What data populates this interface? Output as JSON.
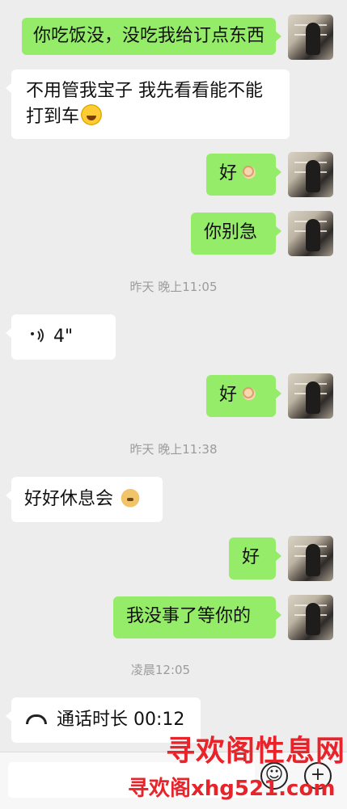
{
  "messages": [
    {
      "side": "right",
      "text": "你吃饭没，没吃我给订点东西"
    },
    {
      "side": "left",
      "line1": "不用管我宝子 我先看看能不能",
      "line2": "打到车",
      "emoji": "laughing-crying-emoji"
    },
    {
      "side": "right",
      "text": "好",
      "emoji": "ok-hand-emoji"
    },
    {
      "side": "right",
      "text": "你别急"
    },
    {
      "time": "昨天 晚上11:05"
    },
    {
      "side": "left",
      "voice_duration": "4\""
    },
    {
      "side": "right",
      "text": "好",
      "emoji": "ok-hand-emoji"
    },
    {
      "time": "昨天 晚上11:38"
    },
    {
      "side": "left",
      "text": "好好休息会",
      "emoji": "doge-emoji"
    },
    {
      "side": "right",
      "text": "好"
    },
    {
      "side": "right",
      "text": "我没事了等你的"
    },
    {
      "time": "凌晨12:05"
    },
    {
      "side": "left",
      "call_label": "通话时长 00:12"
    }
  ],
  "watermark": {
    "line1": "寻欢阁性息网",
    "line2": "寻欢阁xhg521.com"
  },
  "input_bar": {
    "emoji_button": "☺",
    "plus_button": "+"
  },
  "colors": {
    "background": "#ededed",
    "my_bubble": "#95ec69",
    "their_bubble": "#ffffff",
    "watermark": "#e8232a"
  }
}
